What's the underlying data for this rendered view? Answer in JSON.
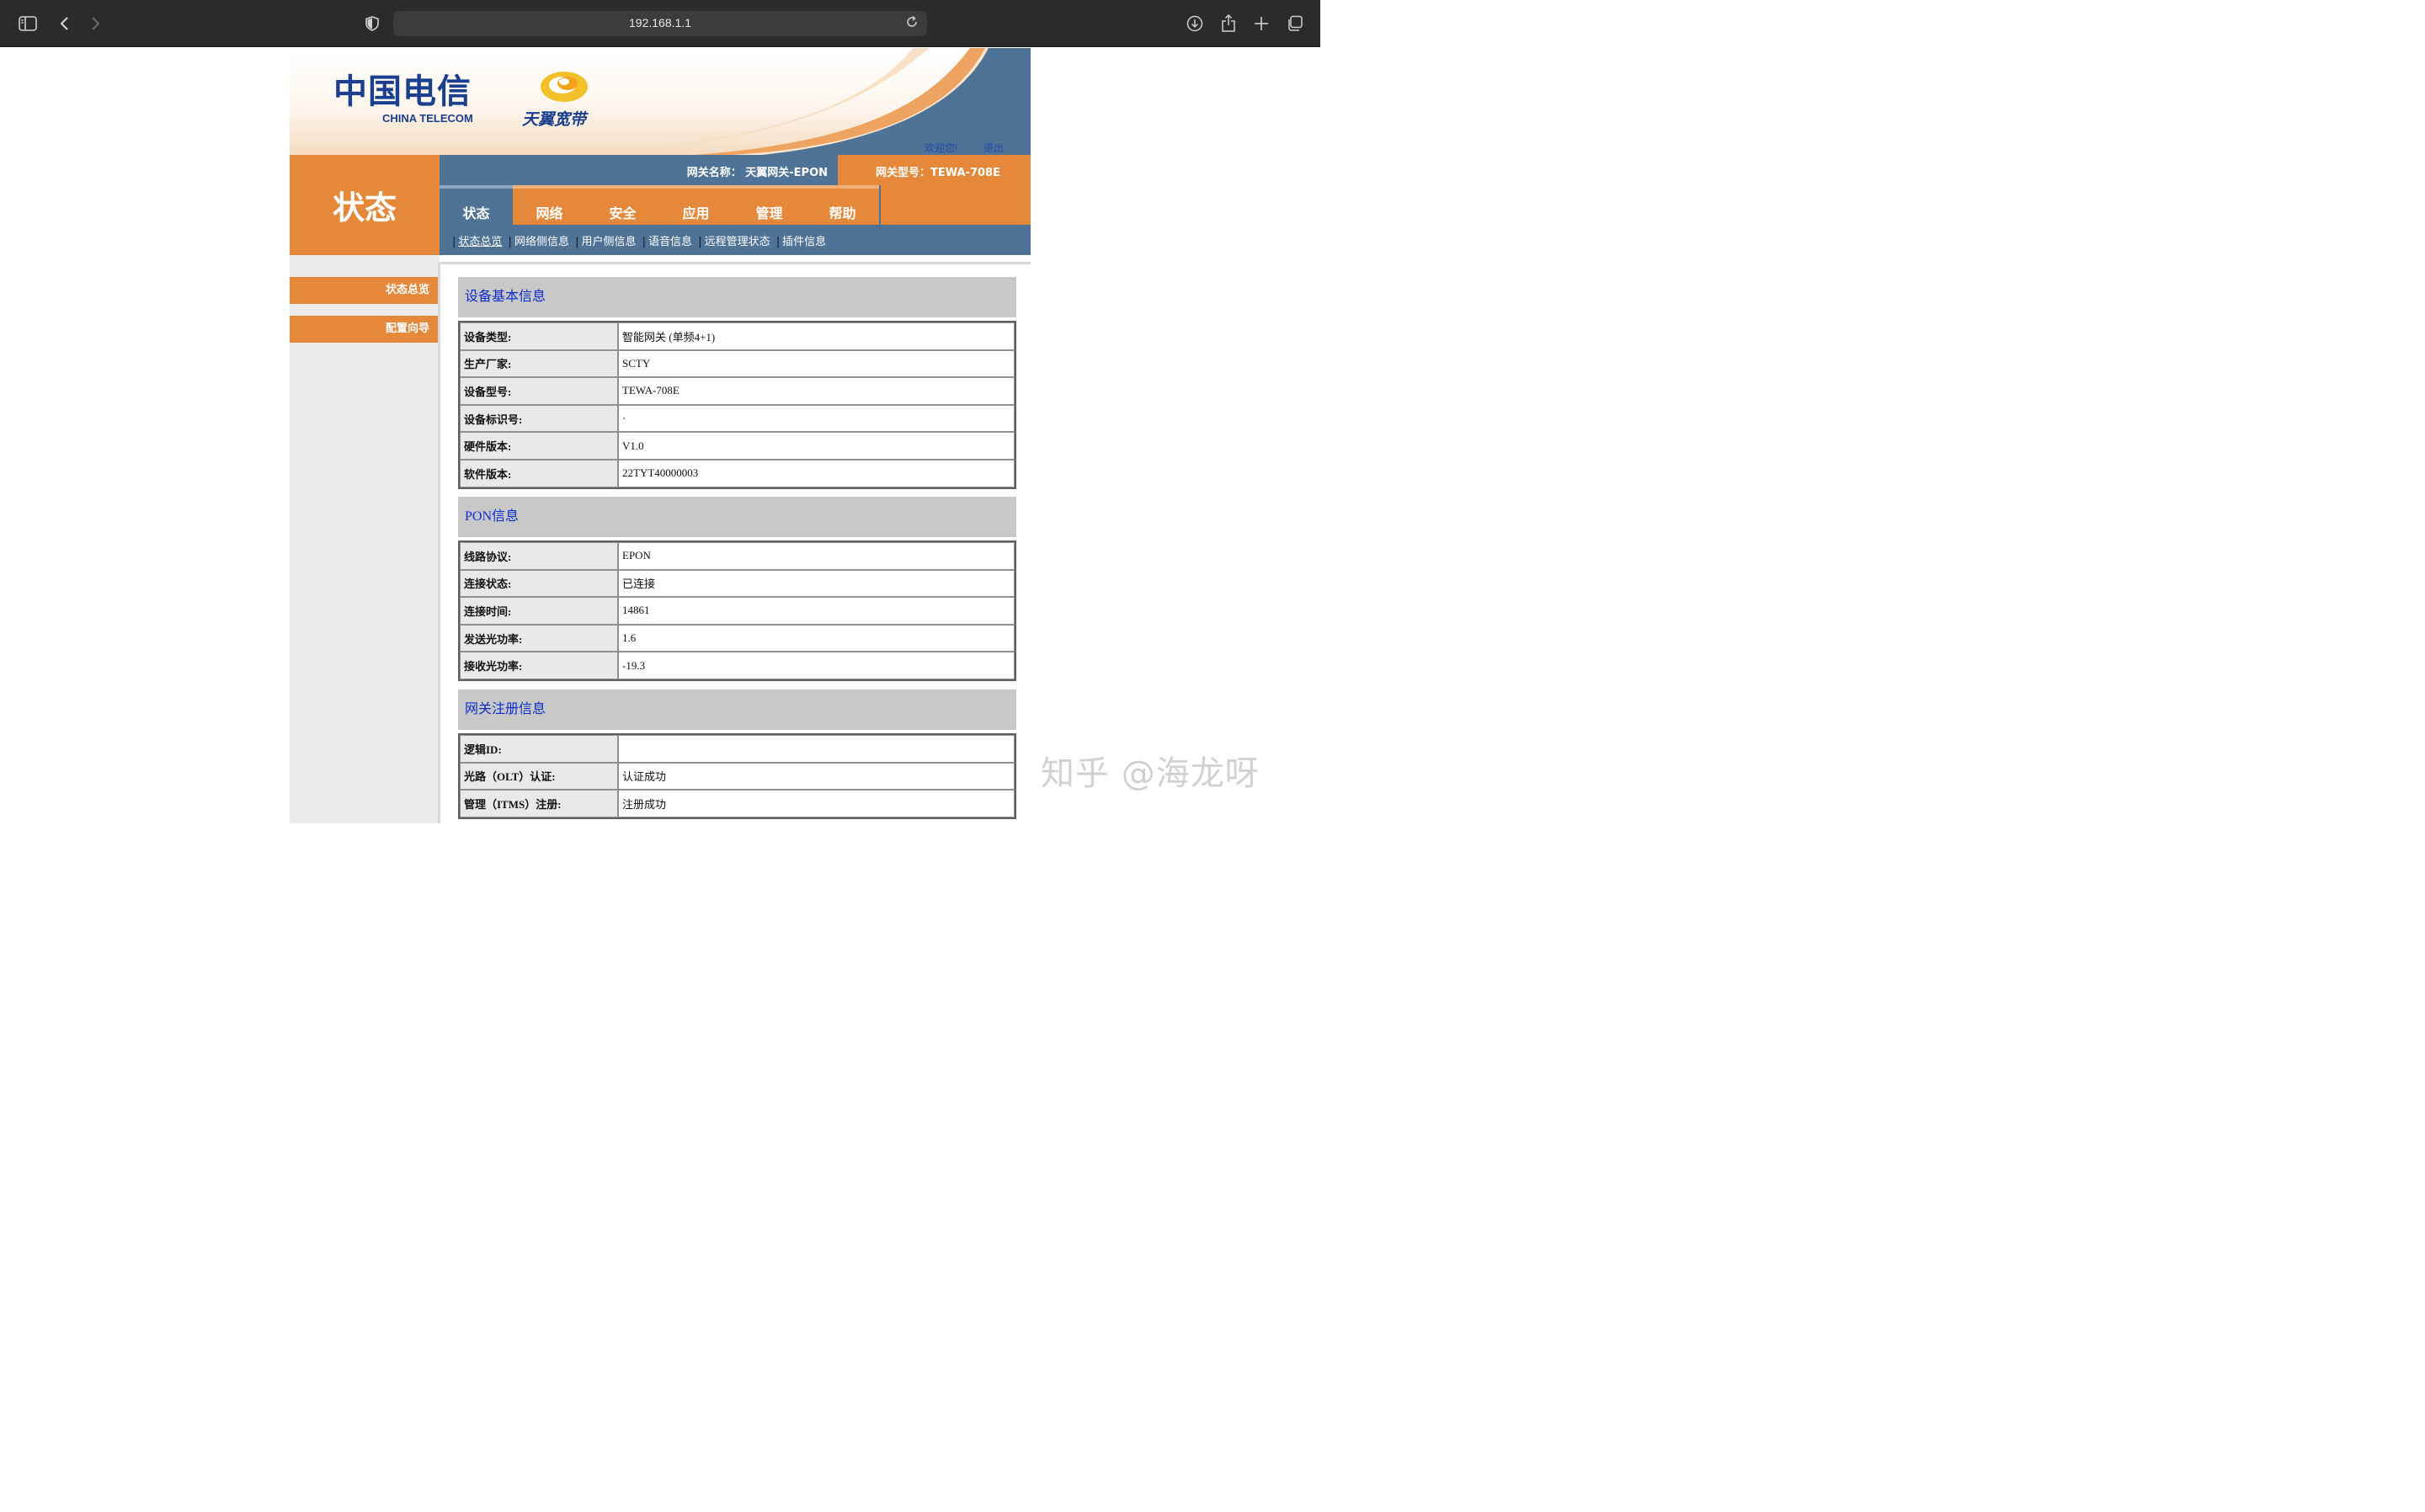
{
  "browser": {
    "url": "192.168.1.1"
  },
  "banner": {
    "logo_cn": "中国电信",
    "logo_en": "CHINA TELECOM",
    "logo_brand": "天翼宽带",
    "welcome": "欢迎您!",
    "logout": "退出"
  },
  "header": {
    "page_title": "状态",
    "gateway_name": "网关名称：  天翼网关-EPON",
    "gateway_model": "网关型号：TEWA-708E"
  },
  "tabs": [
    {
      "label": "状态",
      "active": true
    },
    {
      "label": "网络",
      "active": false
    },
    {
      "label": "安全",
      "active": false
    },
    {
      "label": "应用",
      "active": false
    },
    {
      "label": "管理",
      "active": false
    },
    {
      "label": "帮助",
      "active": false
    }
  ],
  "subnav": [
    {
      "label": "状态总览",
      "active": true
    },
    {
      "label": "网络侧信息"
    },
    {
      "label": "用户侧信息"
    },
    {
      "label": "语音信息"
    },
    {
      "label": "远程管理状态"
    },
    {
      "label": "插件信息"
    }
  ],
  "sidebar": [
    {
      "label": "状态总览"
    },
    {
      "label": "配置向导"
    }
  ],
  "sections": [
    {
      "title": "设备基本信息",
      "rows": [
        {
          "key": "设备类型:",
          "value": "智能网关 (单频4+1)"
        },
        {
          "key": "生产厂家:",
          "value": "SCTY"
        },
        {
          "key": "设备型号:",
          "value": "TEWA-708E"
        },
        {
          "key": "设备标识号:",
          "value": "·"
        },
        {
          "key": "硬件版本:",
          "value": "V1.0"
        },
        {
          "key": "软件版本:",
          "value": "22TYT40000003"
        }
      ]
    },
    {
      "title": "PON信息",
      "rows": [
        {
          "key": "线路协议:",
          "value": "EPON"
        },
        {
          "key": "连接状态:",
          "value": "已连接"
        },
        {
          "key": "连接时间:",
          "value": "14861"
        },
        {
          "key": "发送光功率:",
          "value": "1.6"
        },
        {
          "key": "接收光功率:",
          "value": "-19.3"
        }
      ]
    },
    {
      "title": "网关注册信息",
      "rows": [
        {
          "key": "逻辑ID:",
          "value": ""
        },
        {
          "key": "光路（OLT）认证:",
          "value": "认证成功"
        },
        {
          "key": "管理（ITMS）注册:",
          "value": "注册成功"
        }
      ]
    }
  ],
  "watermark": "知乎 @海龙呀",
  "colors": {
    "orange": "#e5883a",
    "steel_blue": "#4f7396",
    "section_title": "#0d2bd0",
    "link": "#2148a8"
  }
}
